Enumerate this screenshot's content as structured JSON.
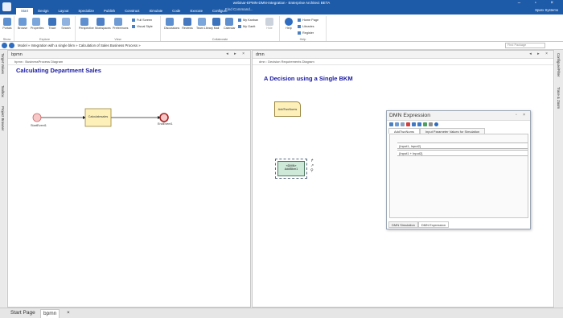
{
  "app": {
    "title": "webinar-EPMN-DMN-Integration - Enterprise Architect BETA",
    "command_placeholder": "Find Command...",
    "user": "Sparx Systems"
  },
  "ribbon_tabs": [
    "Start",
    "Design",
    "Layout",
    "Specialize",
    "Publish",
    "Construct",
    "Simulate",
    "Code",
    "Execute",
    "Configure"
  ],
  "ribbon": {
    "show": {
      "portals": "Portals",
      "group": "Show"
    },
    "explore": {
      "browse": "Browse",
      "properties": "Properties",
      "trace": "Trace",
      "search": "Search",
      "group": "Explore"
    },
    "view": {
      "perspective": "Perspective",
      "workspaces": "Workspaces",
      "preferences": "Preferences",
      "full_screen": "Full Screen",
      "visual_style": "Visual Style",
      "group": "View"
    },
    "collaborate": {
      "discussions": "Discussions",
      "reviews": "Reviews",
      "team_library": "Team Library",
      "mail": "Mail",
      "calendar": "Calendar",
      "kanban": "My Kanban",
      "gantt": "My Gantt",
      "hide": "Hide",
      "group": "Collaborate"
    },
    "help": {
      "help": "Help",
      "home_page": "Home Page",
      "libraries": "Libraries",
      "register": "Register",
      "group": "Help"
    }
  },
  "address": {
    "crumbs": "Model  »  Integration with a single bkm  »  Calculation of Sales Business Process  »",
    "find_placeholder": "Find Package"
  },
  "left_strip": [
    "Target Values",
    "Toolbox",
    "Project Browser"
  ],
  "right_strip": [
    "Configure/Filter",
    "Trace & Zoom"
  ],
  "bpmn_pane": {
    "title": "bpmn",
    "sub": "bpmn : BusinessProcess Diagram",
    "diagram_title": "Calculating Department Sales",
    "start_label": "StartEvent1",
    "task_label": "Calculatesales",
    "end_label": "EndEvent1"
  },
  "dmn_pane": {
    "title": "dmn",
    "sub": "dmn : Decision Requirements Diagram",
    "diagram_title": "A Decision using a Single BKM",
    "input_label": "AddTwoNums",
    "bkm_label": "«DMN»\nAddBkm1"
  },
  "dmn_dialog": {
    "title": "DMN Expression",
    "tabs": [
      "AddTwoNums",
      "Input Parameter Values for Simulation"
    ],
    "rows": [
      "{Input1, Input2}",
      "{Input1 + Input2}"
    ],
    "footer_tabs": [
      "DMN Simulation",
      "DMN Expression"
    ]
  },
  "bottom_tabs": [
    "Start Page",
    "bpmn",
    "×"
  ],
  "colors": {
    "titlebar": "#1d5aa7",
    "diagram_title": "#1a1aa0",
    "start_event": "#f6c8c8",
    "task": "#fdf0b8",
    "bkm_green": "#cfe9d8"
  }
}
